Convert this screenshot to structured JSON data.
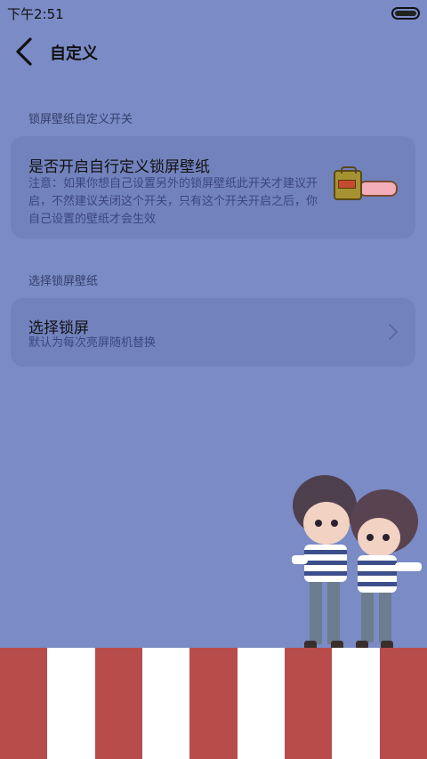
{
  "status_bar": {
    "time": "下午2:51"
  },
  "header": {
    "title": "自定义"
  },
  "sections": [
    {
      "header": "锁屏壁纸自定义开关",
      "card": {
        "title": "是否开启自行定义锁屏壁纸",
        "description": "注意：如果你想自己设置另外的锁屏壁纸此开关才建议开启，不然建议关闭这个开关，只有这个开关开启之后，你自己设置的壁纸才会生效",
        "toggle_on": true
      }
    },
    {
      "header": "选择锁屏壁纸",
      "card": {
        "title": "选择锁屏",
        "subtitle": "默认为每次亮屏随机替换"
      }
    }
  ],
  "colors": {
    "background": "#7a8bc6",
    "card": "#7282bd",
    "stripe_red": "#b84c4a",
    "stripe_white": "#ffffff"
  }
}
